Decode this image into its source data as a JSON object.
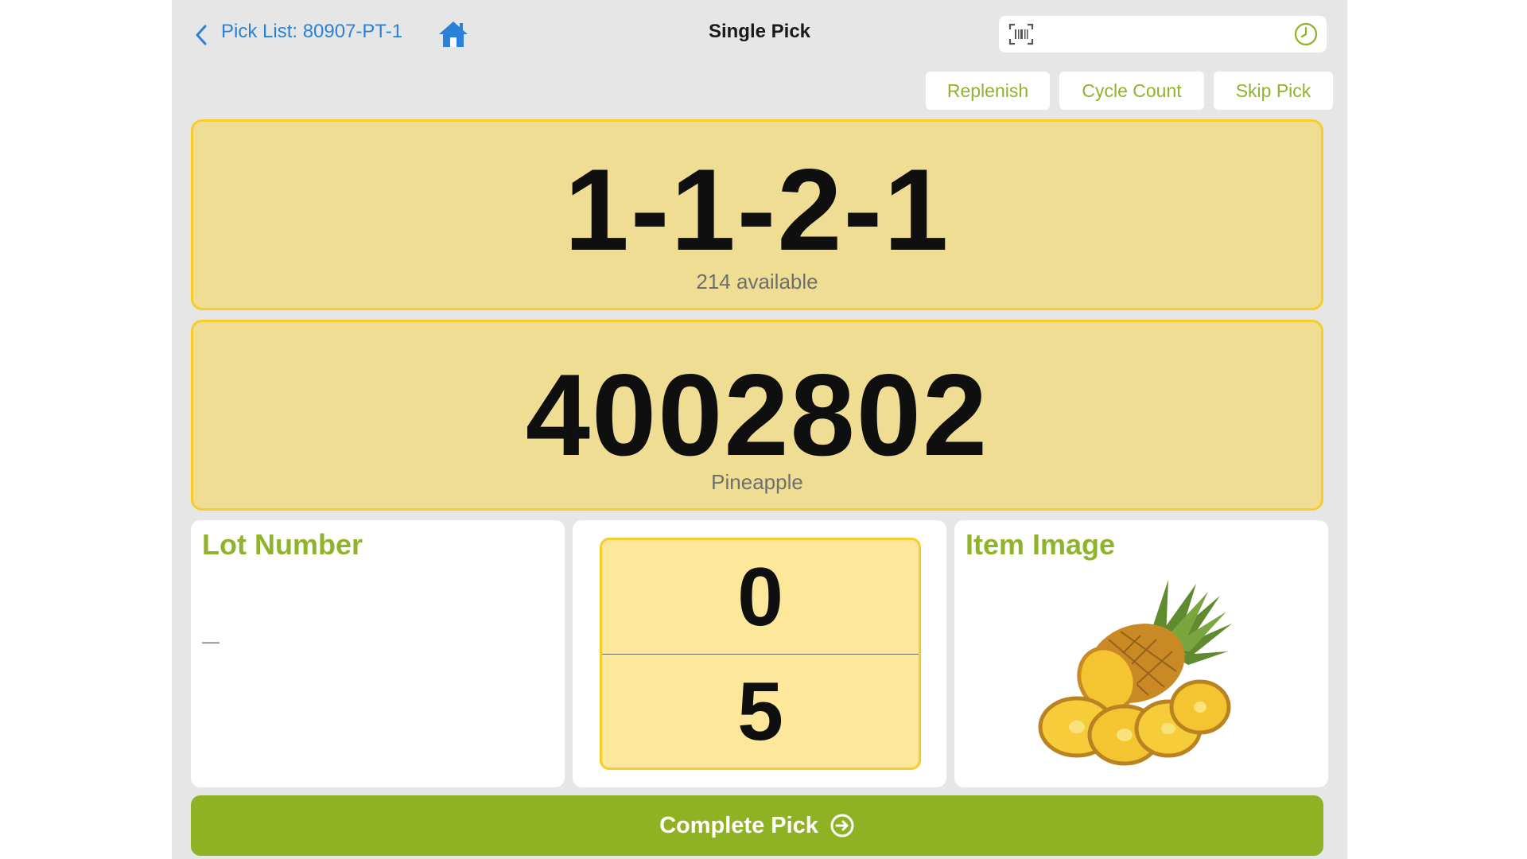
{
  "header": {
    "back_label": "Pick List: 80907-PT-1",
    "title": "Single Pick",
    "scan_placeholder": "",
    "icons": [
      "chevron-left-icon",
      "home-icon",
      "barcode-scan-icon",
      "clock-icon"
    ]
  },
  "actions": {
    "replenish": "Replenish",
    "cycle_count": "Cycle Count",
    "skip_pick": "Skip Pick"
  },
  "location": {
    "code": "1-1-2-1",
    "available": "214 available"
  },
  "item": {
    "code": "4002802",
    "name": "Pineapple"
  },
  "lot": {
    "title": "Lot Number",
    "value": "—"
  },
  "quantity": {
    "picked": "0",
    "required": "5"
  },
  "image_panel": {
    "title": "Item Image"
  },
  "complete": {
    "label": "Complete Pick",
    "icon": "arrow-right-circle-icon"
  },
  "colors": {
    "accent_green": "#8fb224",
    "card_yellow": "#eedd93",
    "card_border": "#f6cd2a",
    "link_blue": "#2a82d8"
  }
}
